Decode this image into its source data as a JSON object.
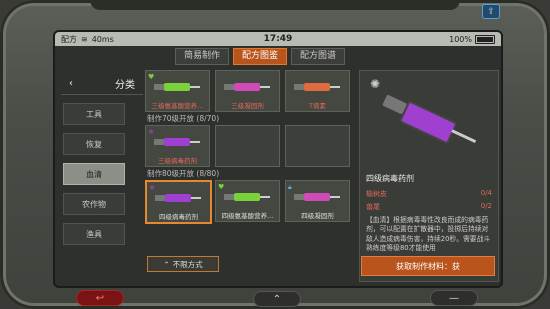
{
  "status": {
    "carrier": "配方",
    "network": "40ms",
    "time": "17:49",
    "battery": "100%"
  },
  "tabs": [
    {
      "label": "简易制作",
      "active": false
    },
    {
      "label": "配方图鉴",
      "active": true
    },
    {
      "label": "配方图谱",
      "active": false
    }
  ],
  "sidebar": {
    "back_icon": "chevron-left-icon",
    "title": "分类",
    "items": [
      {
        "label": "工具",
        "active": false
      },
      {
        "label": "恢复",
        "active": false
      },
      {
        "label": "血清",
        "active": true
      },
      {
        "label": "农作物",
        "active": false
      },
      {
        "label": "渔具",
        "active": false
      }
    ]
  },
  "grid": {
    "row1": [
      {
        "label": "三级氨基酸营养...",
        "color": "#7ad13a"
      },
      {
        "label": "三级凝固剂",
        "color": "#d04ab8"
      },
      {
        "label": "T病素",
        "color": "#e06a40"
      }
    ],
    "section70": "制作70级开放 (8/70)",
    "row2": [
      {
        "label": "三级病毒药剂",
        "color": "#a040d0"
      }
    ],
    "section80": "制作80级开放 (8/80)",
    "row3": [
      {
        "label": "四级病毒药剂",
        "color": "#a040d0"
      },
      {
        "label": "四级氨基酸营养...",
        "color": "#7ad13a"
      },
      {
        "label": "四级凝固剂",
        "color": "#d04ab8"
      }
    ],
    "limit_button": "不限方式"
  },
  "detail": {
    "title": "四级病毒药剂",
    "materials": [
      {
        "name": "榆树皮",
        "count": "0/4"
      },
      {
        "name": "兽尾",
        "count": "0/2"
      }
    ],
    "description": "【血清】根据病毒毒性改良而成的病毒药剂，可以配置在扩散器中，投掷后持续对敌人造成病毒伤害，持续20秒。需要战斗熟练度等级80才能使用",
    "get_button": "获取制作材料：获"
  }
}
